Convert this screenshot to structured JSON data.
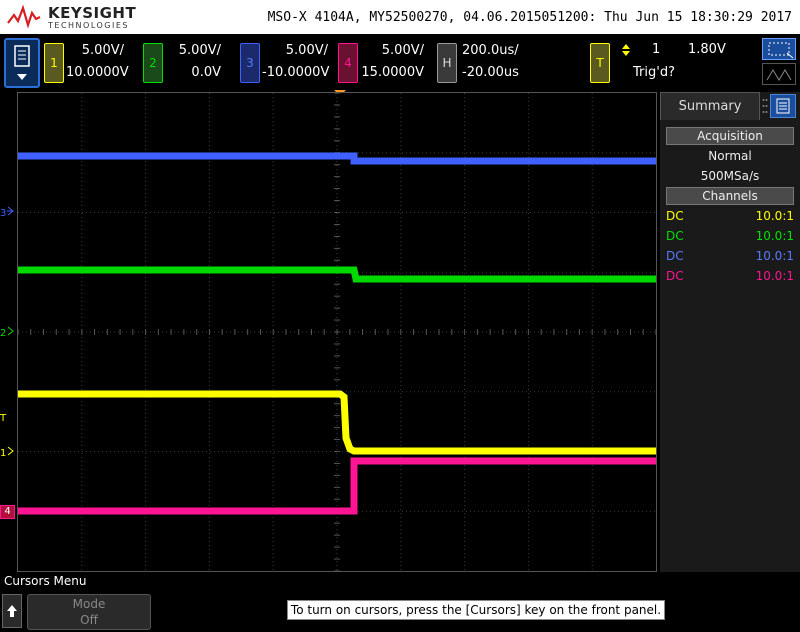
{
  "brand": {
    "name": "KEYSIGHT",
    "sub": "TECHNOLOGIES"
  },
  "instrument_info": "MSO-X 4104A, MY52500270, 04.06.2015051200: Thu Jun 15 18:30:29 2017",
  "channels": [
    {
      "num": "1",
      "scale": "5.00V/",
      "offset": "10.0000V",
      "color": "#ffff00"
    },
    {
      "num": "2",
      "scale": "5.00V/",
      "offset": "0.0V",
      "color": "#00e000"
    },
    {
      "num": "3",
      "scale": "5.00V/",
      "offset": "-10.0000V",
      "color": "#4060ff"
    },
    {
      "num": "4",
      "scale": "5.00V/",
      "offset": "15.0000V",
      "color": "#ff1493"
    }
  ],
  "horizontal": {
    "label": "H",
    "time_per_div": "200.0us/",
    "delay": "-20.00us"
  },
  "trigger": {
    "label": "T",
    "slope_icon": "rising-edge-icon",
    "source": "1",
    "level": "1.80V",
    "status": "Trig'd?"
  },
  "markers": {
    "ch1": "1",
    "ch2": "2",
    "ch3": "3",
    "ch4": "4",
    "trigger": "T"
  },
  "summary": {
    "tab": "Summary",
    "acquisition_title": "Acquisition",
    "mode": "Normal",
    "rate": "500MSa/s",
    "channels_title": "Channels",
    "rows": [
      {
        "coupling": "DC",
        "ratio": "10.0:1",
        "color": "#ffff00"
      },
      {
        "coupling": "DC",
        "ratio": "10.0:1",
        "color": "#00e000"
      },
      {
        "coupling": "DC",
        "ratio": "10.0:1",
        "color": "#4060ff"
      },
      {
        "coupling": "DC",
        "ratio": "10.0:1",
        "color": "#ff1493"
      }
    ]
  },
  "bottom": {
    "menu_title": "Cursors Menu",
    "mode_label": "Mode",
    "mode_value": "Off",
    "hint": "To turn on cursors, press the [Cursors] key on the front panel."
  }
}
